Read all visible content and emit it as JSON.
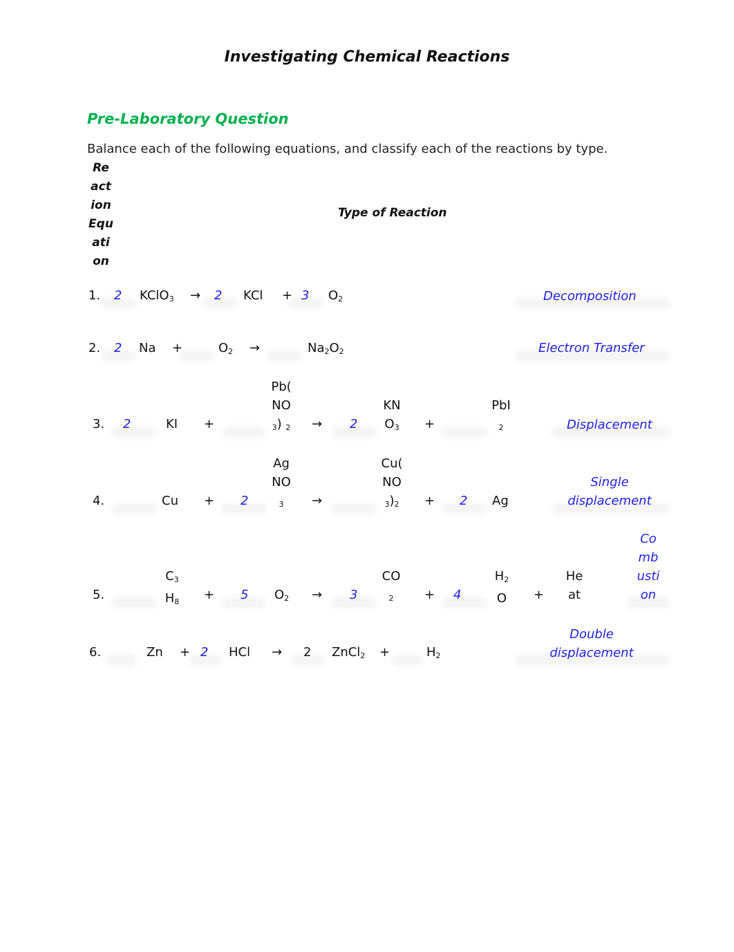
{
  "document": {
    "title": "Investigating Chemical Reactions",
    "section_heading": "Pre-Laboratory Question",
    "instructions": "Balance each of the following equations, and classify each of the reactions by type.",
    "table_headers": {
      "equation_col_lines": [
        "Re",
        "act",
        "ion",
        "Equ",
        "ati",
        "on"
      ],
      "type_col": "Type of Reaction"
    },
    "colors": {
      "heading_green": "#00B050",
      "answer_blue": "#1f1fe6"
    }
  },
  "reactions": [
    {
      "number": "1.",
      "coefficients": [
        "2",
        "2",
        "3"
      ],
      "species": [
        "KClO",
        "3",
        "KCl",
        "O",
        "2"
      ],
      "operators": [
        "→",
        "+"
      ],
      "type": "Decomposition"
    },
    {
      "number": "2.",
      "coefficients": [
        "2",
        "",
        ""
      ],
      "species": [
        "Na",
        "O",
        "2",
        "Na",
        "2",
        "O",
        "2"
      ],
      "operators": [
        "+",
        "→"
      ],
      "type": "Electron Transfer"
    },
    {
      "number": "3.",
      "coefficients": [
        "2",
        "",
        "2",
        ""
      ],
      "species": {
        "ki": "KI",
        "pbno3_lines": [
          "Pb(",
          "NO"
        ],
        "pbno3_sub": "3",
        "pbno3_paren": ")",
        "pbno3_sub2": "2",
        "kno3_lines": [
          "KN",
          "O"
        ],
        "kno3_sub": "3",
        "pbi2_line": "PbI",
        "pbi2_sub": "2"
      },
      "operators": [
        "+",
        "→",
        "+"
      ],
      "type": "Displacement"
    },
    {
      "number": "4.",
      "coefficients": [
        "",
        "2",
        "",
        "2"
      ],
      "species": {
        "cu": "Cu",
        "agno3_lines": [
          "Ag",
          "NO"
        ],
        "agno3_sub": "3",
        "cuno3_lines": [
          "Cu(",
          "NO"
        ],
        "cuno3_sub": "3",
        "cuno3_paren": ")",
        "cuno3_sub2": "2",
        "ag": "Ag"
      },
      "operators": [
        "+",
        "→",
        "+"
      ],
      "type_lines": [
        "Single",
        "displacement"
      ]
    },
    {
      "number": "5.",
      "coefficients": [
        "",
        "5",
        "3",
        "4"
      ],
      "species": {
        "c3h8_top": "C",
        "c3h8_top_sub": "3",
        "c3h8_bot": "H",
        "c3h8_bot_sub": "8",
        "o2": "O",
        "o2_sub": "2",
        "co2_top": "CO",
        "co2_sub": "2",
        "h2o_top": "H",
        "h2o_top_sub": "2",
        "h2o_bot": "O",
        "heat_lines": [
          "He",
          "at"
        ]
      },
      "operators": [
        "+",
        "→",
        "+",
        "+"
      ],
      "type_lines": [
        "Co",
        "mb",
        "usti",
        "on"
      ]
    },
    {
      "number": "6.",
      "coefficients": [
        "",
        "2",
        "2",
        ""
      ],
      "species": {
        "zn": "Zn",
        "hcl": "HCl",
        "zncl2": "ZnCl",
        "zncl2_sub": "2",
        "h2": "H",
        "h2_sub": "2"
      },
      "operators": [
        "+",
        "→",
        "+"
      ],
      "type_lines": [
        "Double",
        "displacement"
      ]
    }
  ]
}
